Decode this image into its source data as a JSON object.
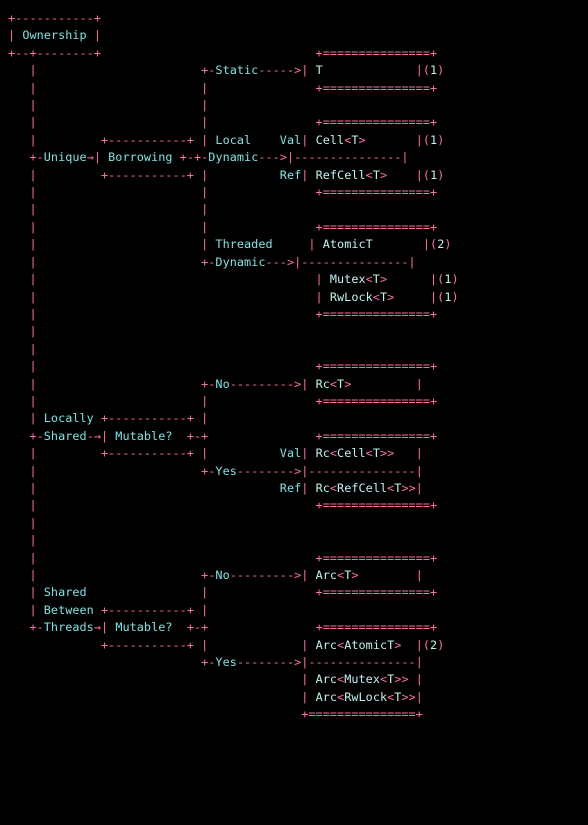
{
  "root": "Ownership",
  "branches": {
    "unique": {
      "label": "Unique",
      "node": "Borrowing",
      "static": {
        "label": "Static",
        "type": "T",
        "note": "1"
      },
      "local_dynamic": {
        "label": "Local",
        "sub": "Dynamic",
        "val": {
          "label": "Val",
          "type": "Cell<T>",
          "note": "1"
        },
        "ref": {
          "label": "Ref",
          "type": "RefCell<T>",
          "note": "1"
        }
      },
      "threaded_dynamic": {
        "label": "Threaded",
        "sub": "Dynamic",
        "items": [
          {
            "type": "AtomicT",
            "note": "2"
          },
          {
            "type": "Mutex<T>",
            "note": "1"
          },
          {
            "type": "RwLock<T>",
            "note": "1"
          }
        ]
      }
    },
    "locally_shared": {
      "label_line1": "Locally",
      "label_line2": "Shared",
      "node": "Mutable?",
      "no": {
        "label": "No",
        "type": "Rc<T>"
      },
      "yes": {
        "label": "Yes",
        "val": {
          "label": "Val",
          "type": "Rc<Cell<T>>"
        },
        "ref": {
          "label": "Ref",
          "type": "Rc<RefCell<T>>"
        }
      }
    },
    "shared_between_threads": {
      "label_line1": "Shared",
      "label_line2": "Between",
      "label_line3": "Threads",
      "node": "Mutable?",
      "no": {
        "label": "No",
        "type": "Arc<T>"
      },
      "yes": {
        "label": "Yes",
        "items": [
          {
            "type": "Arc<AtomicT>",
            "note": "2"
          },
          {
            "type": "Arc<Mutex<T>>"
          },
          {
            "type": "Arc<RwLock<T>>"
          }
        ]
      }
    }
  },
  "chart_data": {
    "type": "table",
    "title": "Ownership",
    "rows": [
      {
        "ownership": "Unique",
        "borrowing": "Static",
        "kind": "",
        "type": "T",
        "note": 1
      },
      {
        "ownership": "Unique",
        "borrowing": "Local Dynamic",
        "kind": "Val",
        "type": "Cell<T>",
        "note": 1
      },
      {
        "ownership": "Unique",
        "borrowing": "Local Dynamic",
        "kind": "Ref",
        "type": "RefCell<T>",
        "note": 1
      },
      {
        "ownership": "Unique",
        "borrowing": "Threaded Dynamic",
        "kind": "",
        "type": "AtomicT",
        "note": 2
      },
      {
        "ownership": "Unique",
        "borrowing": "Threaded Dynamic",
        "kind": "",
        "type": "Mutex<T>",
        "note": 1
      },
      {
        "ownership": "Unique",
        "borrowing": "Threaded Dynamic",
        "kind": "",
        "type": "RwLock<T>",
        "note": 1
      },
      {
        "ownership": "Locally Shared",
        "mutable": "No",
        "kind": "",
        "type": "Rc<T>"
      },
      {
        "ownership": "Locally Shared",
        "mutable": "Yes",
        "kind": "Val",
        "type": "Rc<Cell<T>>"
      },
      {
        "ownership": "Locally Shared",
        "mutable": "Yes",
        "kind": "Ref",
        "type": "Rc<RefCell<T>>"
      },
      {
        "ownership": "Shared Between Threads",
        "mutable": "No",
        "kind": "",
        "type": "Arc<T>"
      },
      {
        "ownership": "Shared Between Threads",
        "mutable": "Yes",
        "kind": "",
        "type": "Arc<AtomicT>",
        "note": 2
      },
      {
        "ownership": "Shared Between Threads",
        "mutable": "Yes",
        "kind": "",
        "type": "Arc<Mutex<T>>"
      },
      {
        "ownership": "Shared Between Threads",
        "mutable": "Yes",
        "kind": "",
        "type": "Arc<RwLock<T>>"
      }
    ]
  }
}
